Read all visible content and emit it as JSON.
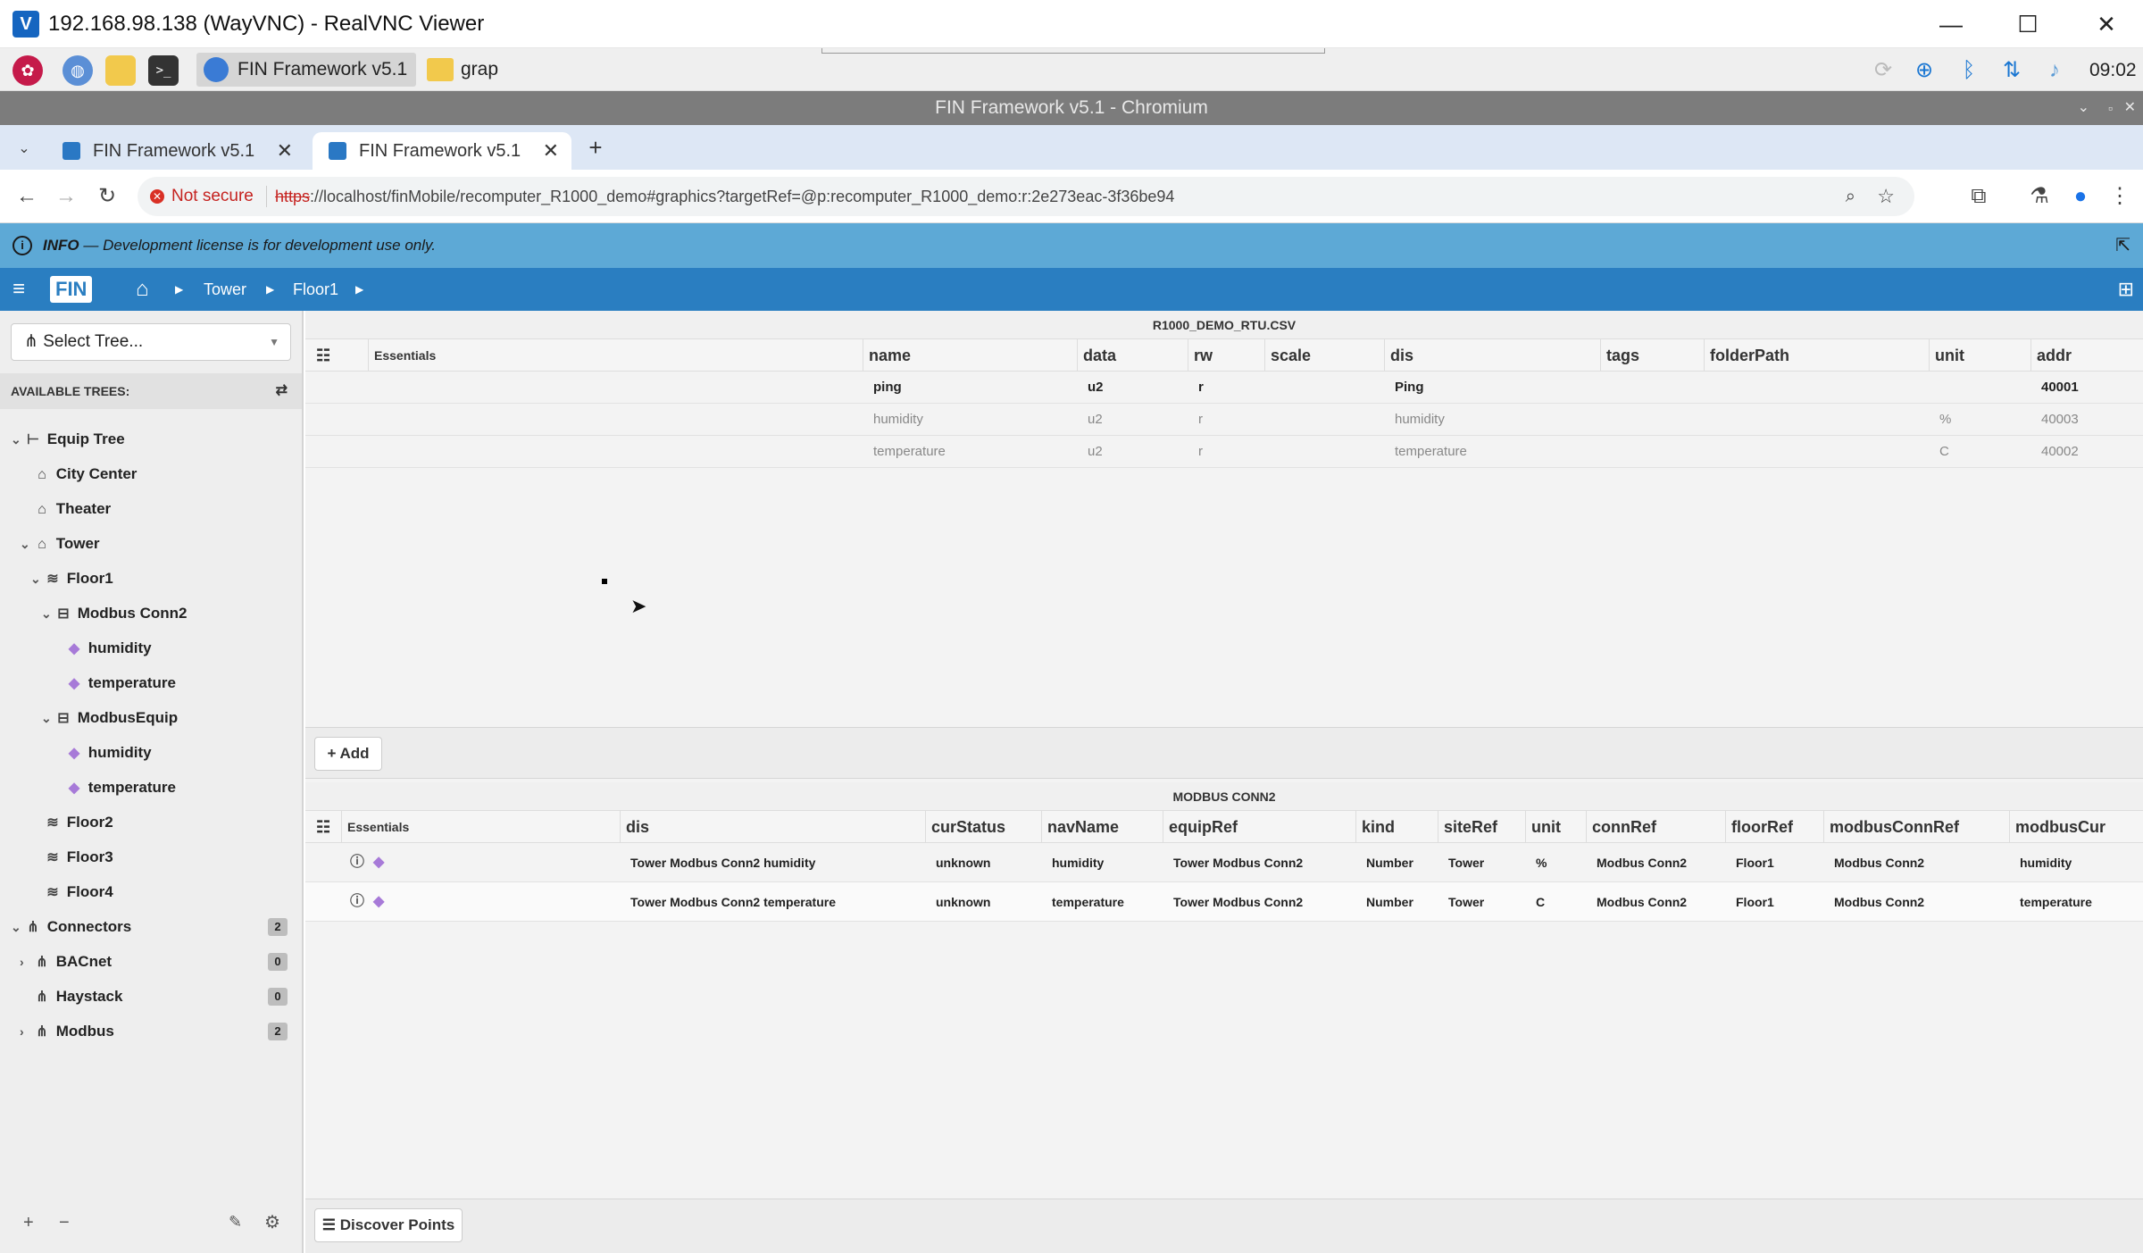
{
  "vnc": {
    "title": "192.168.98.138 (WayVNC) - RealVNC Viewer",
    "minimize": "—",
    "maximize": "☐",
    "close": "✕"
  },
  "taskbar": {
    "task1": "FIN Framework v5.1 ..",
    "task2": "grap",
    "clock": "09:02"
  },
  "chrome": {
    "window_title": "FIN Framework v5.1 - Chromium",
    "tabs": [
      {
        "label": "FIN Framework v5.1"
      },
      {
        "label": "FIN Framework v5.1"
      }
    ],
    "not_secure": "Not secure",
    "url_scheme": "https",
    "url_rest": "://localhost/finMobile/recomputer_R1000_demo#graphics?targetRef=@p:recomputer_R1000_demo:r:2e273eac-3f36be94"
  },
  "info": {
    "label": "INFO",
    "message": "— Development license is for development use only."
  },
  "appbar": {
    "logo": "FIN",
    "crumbs": [
      "Tower",
      "Floor1"
    ]
  },
  "sidebar": {
    "select_tree": "Select Tree...",
    "available_trees": "AVAILABLE TREES:",
    "items": [
      {
        "label": "Equip Tree",
        "badge": ""
      },
      {
        "label": "City Center",
        "badge": ""
      },
      {
        "label": "Theater",
        "badge": ""
      },
      {
        "label": "Tower",
        "badge": ""
      },
      {
        "label": "Floor1",
        "badge": ""
      },
      {
        "label": "Modbus Conn2",
        "badge": ""
      },
      {
        "label": "humidity",
        "badge": ""
      },
      {
        "label": "temperature",
        "badge": ""
      },
      {
        "label": "ModbusEquip",
        "badge": ""
      },
      {
        "label": "humidity",
        "badge": ""
      },
      {
        "label": "temperature",
        "badge": ""
      },
      {
        "label": "Floor2",
        "badge": ""
      },
      {
        "label": "Floor3",
        "badge": ""
      },
      {
        "label": "Floor4",
        "badge": ""
      },
      {
        "label": "Connectors",
        "badge": "2"
      },
      {
        "label": "BACnet",
        "badge": "0"
      },
      {
        "label": "Haystack",
        "badge": "0"
      },
      {
        "label": "Modbus",
        "badge": "2"
      }
    ]
  },
  "grid1": {
    "title": "R1000_DEMO_RTU.CSV",
    "columns": [
      "Essentials",
      "name",
      "data",
      "rw",
      "scale",
      "dis",
      "tags",
      "folderPath",
      "unit",
      "addr"
    ],
    "rows": [
      [
        "ping",
        "u2",
        "r",
        "",
        "Ping",
        "",
        "",
        "",
        "40001"
      ],
      [
        "humidity",
        "u2",
        "r",
        "",
        "humidity",
        "",
        "",
        "%",
        "40003"
      ],
      [
        "temperature",
        "u2",
        "r",
        "",
        "temperature",
        "",
        "",
        "C",
        "40002"
      ]
    ],
    "add": "+ Add"
  },
  "grid2": {
    "title": "MODBUS CONN2",
    "columns": [
      "Essentials",
      "dis",
      "curStatus",
      "navName",
      "equipRef",
      "kind",
      "siteRef",
      "unit",
      "connRef",
      "floorRef",
      "modbusConnRef",
      "modbusCur"
    ],
    "rows": [
      [
        "Tower Modbus Conn2 humidity",
        "unknown",
        "humidity",
        "Tower Modbus Conn2",
        "Number",
        "Tower",
        "%",
        "Modbus Conn2",
        "Floor1",
        "Modbus Conn2",
        "humidity"
      ],
      [
        "Tower Modbus Conn2 temperature",
        "unknown",
        "temperature",
        "Tower Modbus Conn2",
        "Number",
        "Tower",
        "C",
        "Modbus Conn2",
        "Floor1",
        "Modbus Conn2",
        "temperature"
      ]
    ]
  },
  "discover": "Discover Points",
  "sidebar_footer": {
    "plus": "+",
    "minus": "−"
  }
}
